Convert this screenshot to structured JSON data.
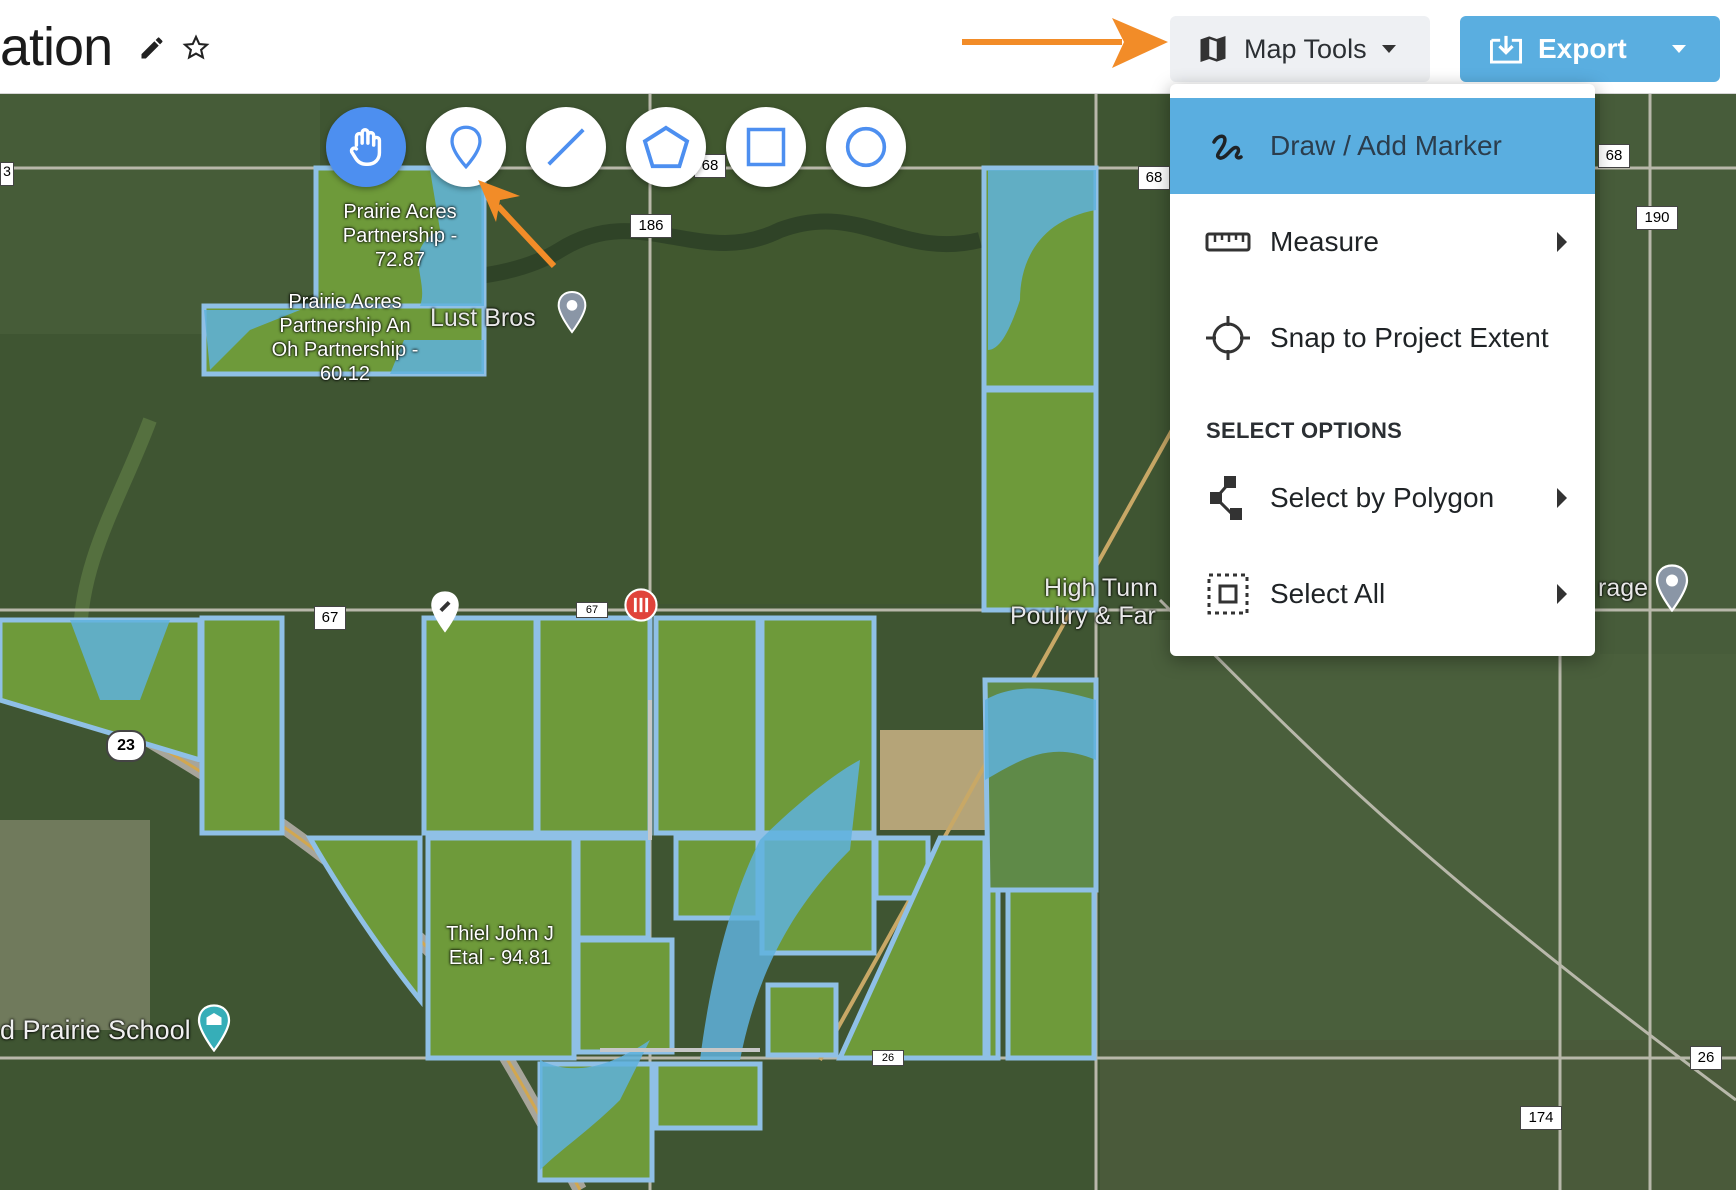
{
  "header": {
    "title": "ation",
    "map_tools_label": "Map Tools",
    "export_label": "Export"
  },
  "toolbar": {
    "tools": [
      {
        "name": "pan",
        "icon": "hand-icon",
        "active": true
      },
      {
        "name": "marker",
        "icon": "map-pin-icon",
        "active": false
      },
      {
        "name": "line",
        "icon": "line-icon",
        "active": false
      },
      {
        "name": "polygon",
        "icon": "polygon-icon",
        "active": false
      },
      {
        "name": "rectangle",
        "icon": "square-icon",
        "active": false
      },
      {
        "name": "circle",
        "icon": "circle-icon",
        "active": false
      }
    ]
  },
  "menu": {
    "items": [
      {
        "label": "Draw / Add Marker",
        "icon": "draw-squiggle-icon",
        "selected": true
      },
      {
        "label": "Measure",
        "icon": "ruler-icon",
        "has_submenu": true
      },
      {
        "label": "Snap to Project Extent",
        "icon": "crosshair-icon"
      }
    ],
    "section_label": "SELECT OPTIONS",
    "select_items": [
      {
        "label": "Select by Polygon",
        "icon": "polygon-nodes-icon",
        "has_submenu": true
      },
      {
        "label": "Select All",
        "icon": "dotted-square-icon",
        "has_submenu": true
      }
    ]
  },
  "map": {
    "parcel_labels": [
      {
        "text": "Prairie Acres\nPartnership -\n72.87"
      },
      {
        "text": "Prairie Acres\nPartnership An\nOh Partnership -\n60.12"
      },
      {
        "text": "Thiel John J\nEtal - 94.81"
      }
    ],
    "place_labels": {
      "lust_bros": "Lust Bros",
      "high_tunnel": "High Tunn",
      "poultry": "Poultry & Far",
      "prairie_school": "d Prairie School",
      "storage": "rage"
    },
    "road_labels": [
      "3",
      "68",
      "186",
      "68",
      "68",
      "190",
      "67",
      "67",
      "23",
      "26",
      "26",
      "174"
    ]
  },
  "colors": {
    "accent": "#5aaee0",
    "active_tool": "#4d8ff0",
    "arrow": "#f28c28",
    "parcel_fill": "#6e9a3a",
    "water": "#5fb2dd"
  }
}
